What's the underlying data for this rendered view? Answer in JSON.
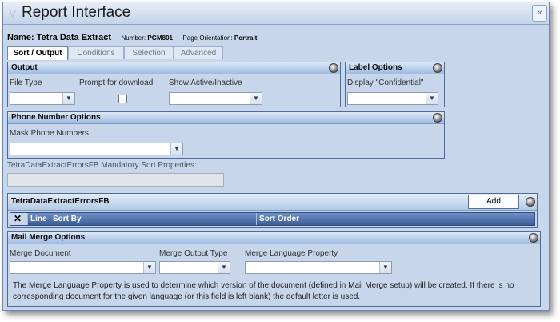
{
  "window": {
    "title": "Report Interface",
    "collapse_glyph": "«"
  },
  "header": {
    "name_label": "Name: Tetra Data Extract",
    "number_label": "Number:",
    "number_value": "PGM801",
    "orientation_label": "Page Orientation:",
    "orientation_value": "Portrait"
  },
  "tabs": [
    {
      "label": "Sort / Output",
      "active": true
    },
    {
      "label": "Conditions"
    },
    {
      "label": "Selection"
    },
    {
      "label": "Advanced"
    }
  ],
  "output": {
    "title": "Output",
    "file_type_label": "File Type",
    "file_type_value": "",
    "prompt_label": "Prompt for download",
    "prompt_checked": false,
    "show_label": "Show Active/Inactive",
    "show_value": ""
  },
  "label_options": {
    "title": "Label Options",
    "display_label": "Display \"Confidential\"",
    "display_value": ""
  },
  "phone": {
    "title": "Phone Number Options",
    "mask_label": "Mask Phone Numbers",
    "mask_value": ""
  },
  "mandatory": {
    "label": "TetraDataExtractErrorsFB Mandatory Sort Properties:",
    "value": ""
  },
  "sort_grid": {
    "title": "TetraDataExtractErrorsFB",
    "add_label": "Add",
    "columns": [
      "Line",
      "Sort By",
      "Sort Order"
    ]
  },
  "mail_merge": {
    "title": "Mail Merge Options",
    "doc_label": "Merge Document",
    "output_label": "Merge Output Type",
    "lang_label": "Merge Language Property",
    "note": "The Merge Language Property is used to determine which version of the document (defined in Mail Merge setup) will be created. If there is no corresponding document for the given language (or this field is left blank) the default letter is used."
  },
  "icons": {
    "dropdown": "chevron-down-icon",
    "gear": "gear-icon",
    "delete": "x-icon",
    "title": "triangle-icon"
  },
  "colors": {
    "panel_bg": "#c7d6ea",
    "header_blue": "#3c5e98",
    "border": "#4f6b98"
  }
}
